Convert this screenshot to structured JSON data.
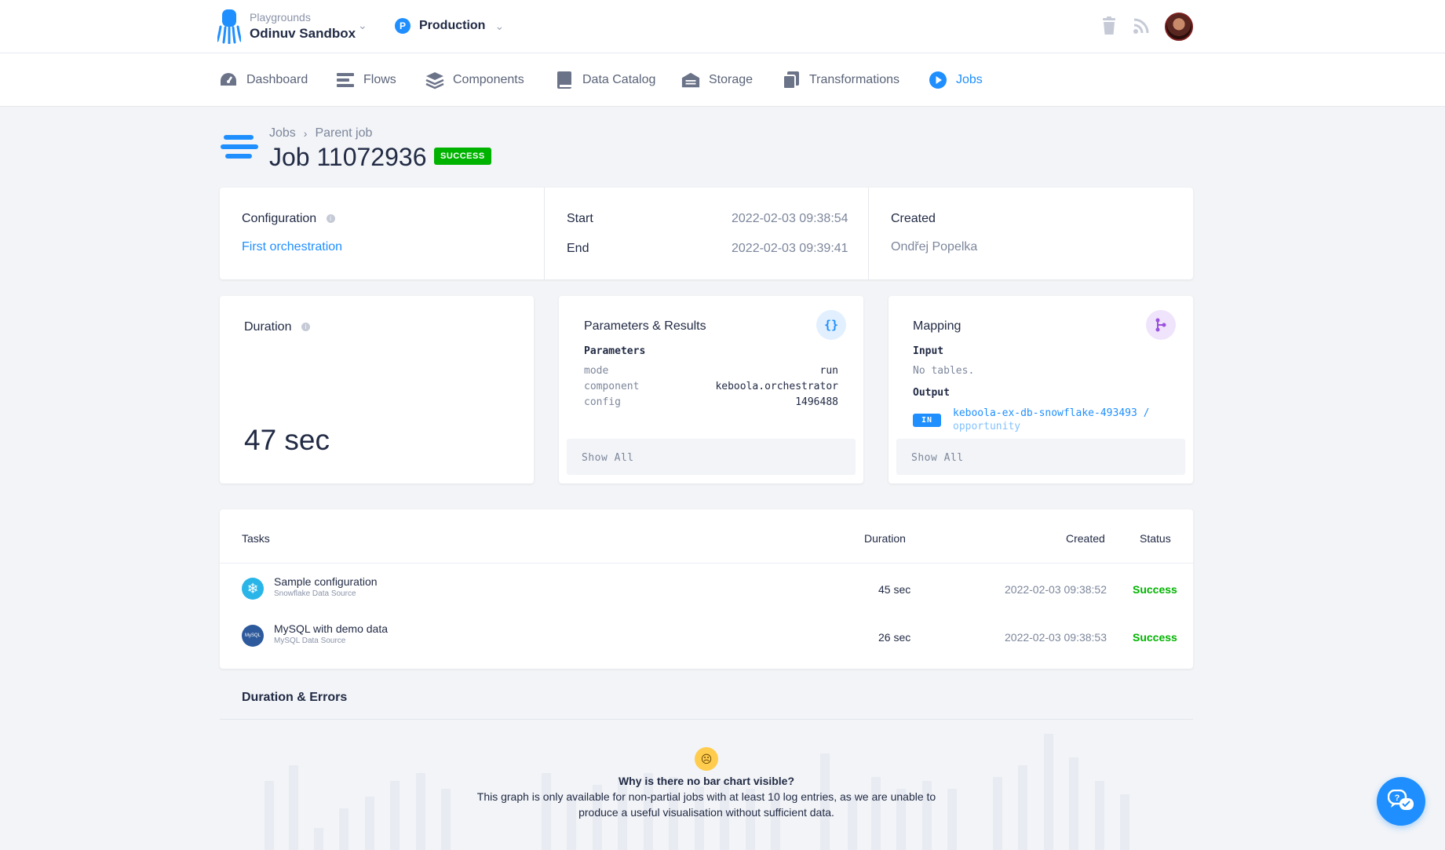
{
  "topbar": {
    "project_label": "Playgrounds",
    "project_name": "Odinuv Sandbox",
    "branch_letter": "P",
    "branch_name": "Production",
    "icons": [
      "trash-icon",
      "rss-icon"
    ]
  },
  "nav": {
    "items": [
      {
        "label": "Dashboard",
        "icon": "dashboard-icon"
      },
      {
        "label": "Flows",
        "icon": "flows-icon"
      },
      {
        "label": "Components",
        "icon": "components-icon"
      },
      {
        "label": "Data Catalog",
        "icon": "book-icon"
      },
      {
        "label": "Storage",
        "icon": "storage-icon"
      },
      {
        "label": "Transformations",
        "icon": "transformations-icon"
      },
      {
        "label": "Jobs",
        "icon": "play-icon",
        "active": true
      }
    ]
  },
  "header": {
    "breadcrumb": [
      "Jobs",
      "Parent job"
    ],
    "title": "Job 11072936",
    "status": "SUCCESS"
  },
  "summary": {
    "configuration_label": "Configuration",
    "configuration_value": "First orchestration",
    "start_label": "Start",
    "start_value": "2022-02-03 09:38:54",
    "end_label": "End",
    "end_value": "2022-02-03 09:39:41",
    "created_label": "Created",
    "created_value": "Ondřej Popelka"
  },
  "duration": {
    "label": "Duration",
    "value": "47 sec"
  },
  "parameters": {
    "title": "Parameters & Results",
    "section": "Parameters",
    "rows": [
      {
        "key": "mode",
        "value": "run"
      },
      {
        "key": "component",
        "value": "keboola.orchestrator"
      },
      {
        "key": "config",
        "value": "1496488"
      }
    ],
    "show_all": "Show All"
  },
  "mapping": {
    "title": "Mapping",
    "input_label": "Input",
    "input_value": "No tables.",
    "output_label": "Output",
    "output_badge": "IN",
    "output_bucket": "keboola-ex-db-snowflake-493493 /",
    "output_table": "opportunity",
    "show_all": "Show All"
  },
  "tasks": {
    "headers": {
      "tasks": "Tasks",
      "duration": "Duration",
      "created": "Created",
      "status": "Status"
    },
    "rows": [
      {
        "name": "Sample configuration",
        "type": "Snowflake Data Source",
        "duration": "45 sec",
        "created": "2022-02-03 09:38:52",
        "status": "Success",
        "icon": "snowflake-icon"
      },
      {
        "name": "MySQL with demo data",
        "type": "MySQL Data Source",
        "duration": "26 sec",
        "created": "2022-02-03 09:38:53",
        "status": "Success",
        "icon": "mysql-icon"
      }
    ]
  },
  "duration_errors": {
    "title": "Duration & Errors",
    "empty_title": "Why is there no bar chart visible?",
    "empty_text": "This graph is only available for non-partial jobs with at least 10 log entries, as we are unable to produce a useful visualisation without sufficient data."
  },
  "colors": {
    "accent": "#1f8fff",
    "success": "#00b300",
    "text": "#222b45",
    "muted": "#7c869b"
  }
}
